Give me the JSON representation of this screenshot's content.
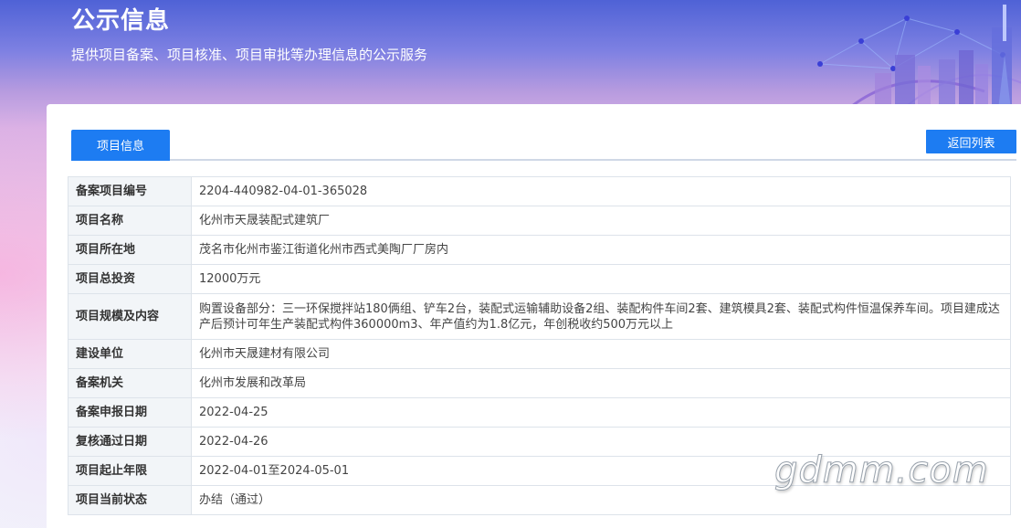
{
  "header": {
    "title": "公示信息",
    "subtitle": "提供项目备案、项目核准、项目审批等办理信息的公示服务"
  },
  "tabs": [
    {
      "label": "项目信息",
      "active": true
    }
  ],
  "actions": {
    "back_label": "返回列表"
  },
  "colors": {
    "accent": "#1d7cf2",
    "label_bg": "#f2f5f8",
    "border": "#dde3ea"
  },
  "rows": [
    {
      "label": "备案项目编号",
      "value": "2204-440982-04-01-365028"
    },
    {
      "label": "项目名称",
      "value": "化州市天晟装配式建筑厂"
    },
    {
      "label": "项目所在地",
      "value": "茂名市化州市鉴江街道化州市西式美陶厂厂房内"
    },
    {
      "label": "项目总投资",
      "value": "12000万元"
    },
    {
      "label": "项目规模及内容",
      "value": "购置设备部分：三一环保搅拌站180俩组、铲车2台，装配式运输辅助设备2组、装配构件车间2套、建筑模具2套、装配式构件恒温保养车间。项目建成达产后预计可年生产装配式构件360000m3、年产值约为1.8亿元，年创税收约500万元以上"
    },
    {
      "label": "建设单位",
      "value": "化州市天晟建材有限公司"
    },
    {
      "label": "备案机关",
      "value": "化州市发展和改革局"
    },
    {
      "label": "备案申报日期",
      "value": "2022-04-25"
    },
    {
      "label": "复核通过日期",
      "value": "2022-04-26"
    },
    {
      "label": "项目起止年限",
      "value": "2022-04-01至2024-05-01"
    },
    {
      "label": "项目当前状态",
      "value": "办结（通过）"
    }
  ],
  "watermark": "gdmm.com"
}
